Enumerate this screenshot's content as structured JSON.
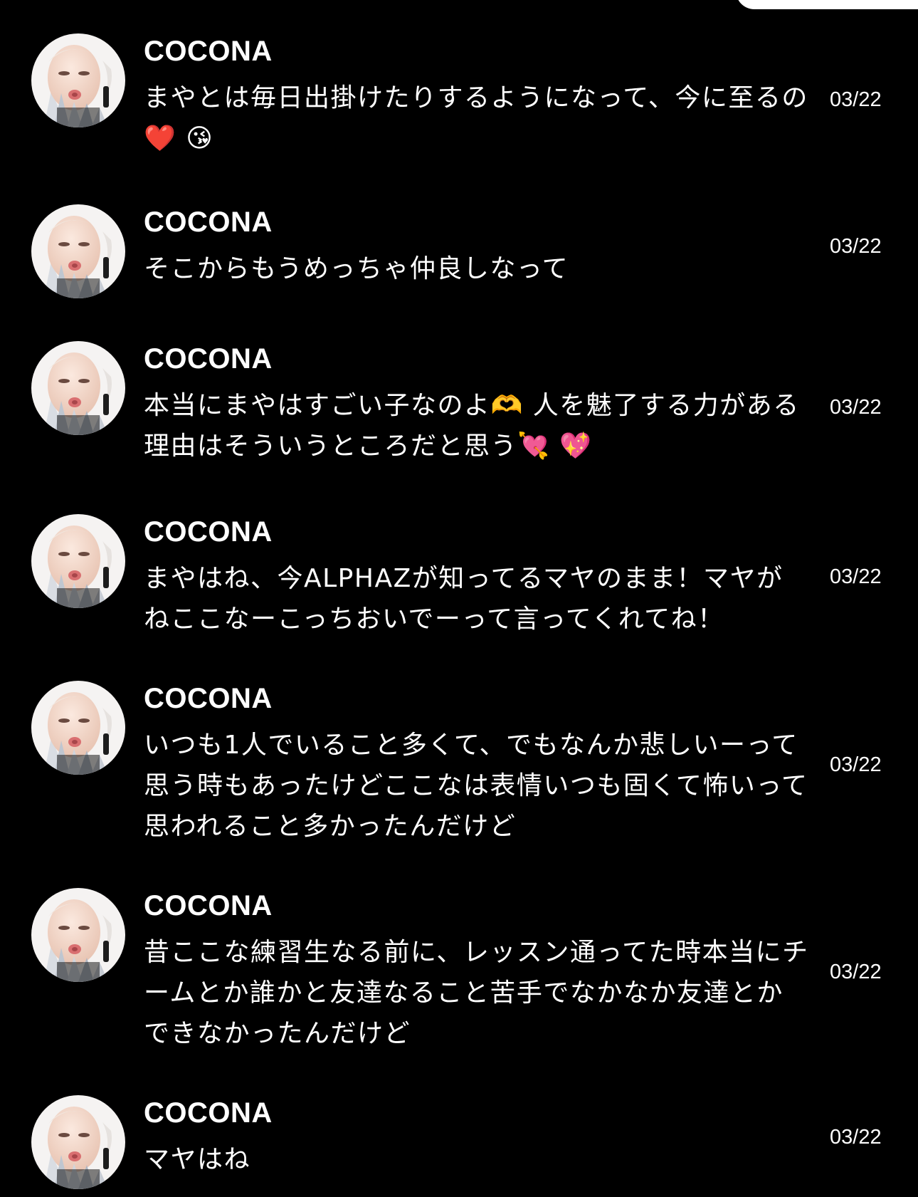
{
  "conversation": {
    "messages": [
      {
        "sender": "COCONA",
        "text": "まやとは毎日出掛けたりするようになって、今に至るの❤️ 😘",
        "time": "03/22"
      },
      {
        "sender": "COCONA",
        "text": "そこからもうめっちゃ仲良しなって",
        "time": "03/22"
      },
      {
        "sender": "COCONA",
        "text": "本当にまやはすごい子なのよ🫶 人を魅了する力がある理由はそういうところだと思う💘 💖",
        "time": "03/22"
      },
      {
        "sender": "COCONA",
        "text": "まやはね、今ALPHAZが知ってるマヤのまま！マヤがねここなーこっちおいでーって言ってくれてね！",
        "time": "03/22"
      },
      {
        "sender": "COCONA",
        "text": "いつも1人でいること多くて、でもなんか悲しいーって思う時もあったけどここなは表情いつも固くて怖いって思われること多かったんだけど",
        "time": "03/22"
      },
      {
        "sender": "COCONA",
        "text": "昔ここな練習生なる前に、レッスン通ってた時本当にチームとか誰かと友達なること苦手でなかなか友達とかできなかったんだけど",
        "time": "03/22"
      },
      {
        "sender": "COCONA",
        "text": "マヤはね",
        "time": "03/22"
      }
    ]
  },
  "theme": {
    "background": "#000000",
    "text": "#ffffff"
  },
  "icons": {
    "avatar": "profile-photo"
  }
}
